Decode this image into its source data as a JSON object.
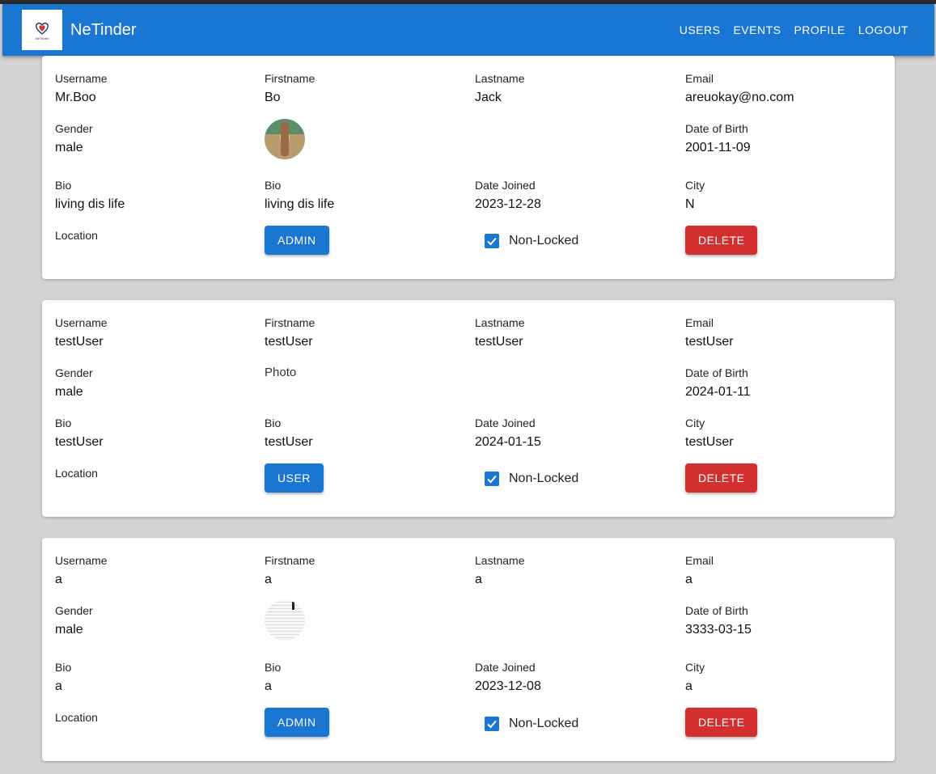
{
  "app": {
    "brand": "NeTinder",
    "logo_caption": "NeTinder",
    "nav": [
      "USERS",
      "EVENTS",
      "PROFILE",
      "LOGOUT"
    ]
  },
  "labels": {
    "username": "Username",
    "firstname": "Firstname",
    "lastname": "Lastname",
    "email": "Email",
    "gender": "Gender",
    "photo": "Photo",
    "dob": "Date of Birth",
    "bio": "Bio",
    "date_joined": "Date Joined",
    "city": "City",
    "location": "Location",
    "non_locked": "Non-Locked",
    "delete": "DELETE"
  },
  "users": [
    {
      "username": "Mr.Boo",
      "firstname": "Bo",
      "lastname": "Jack",
      "email": "areuokay@no.com",
      "gender": "male",
      "dob": "2001-11-09",
      "bio": "living dis life",
      "bio2": "living dis life",
      "date_joined": "2023-12-28",
      "city": "N",
      "role": "ADMIN",
      "non_locked": true,
      "has_photo": true
    },
    {
      "username": "testUser",
      "firstname": "testUser",
      "lastname": "testUser",
      "email": "testUser",
      "gender": "male",
      "dob": "2024-01-11",
      "bio": "testUser",
      "bio2": "testUser",
      "date_joined": "2024-01-15",
      "city": "testUser",
      "role": "USER",
      "non_locked": true,
      "has_photo": false
    },
    {
      "username": "a",
      "firstname": "a",
      "lastname": "a",
      "email": "a",
      "gender": "male",
      "dob": "3333-03-15",
      "bio": "a",
      "bio2": "a",
      "date_joined": "2023-12-08",
      "city": "a",
      "role": "ADMIN",
      "non_locked": true,
      "has_photo": true
    }
  ],
  "colors": {
    "primary": "#1976d2",
    "danger": "#d32f2f",
    "background": "#d3d3d3"
  }
}
